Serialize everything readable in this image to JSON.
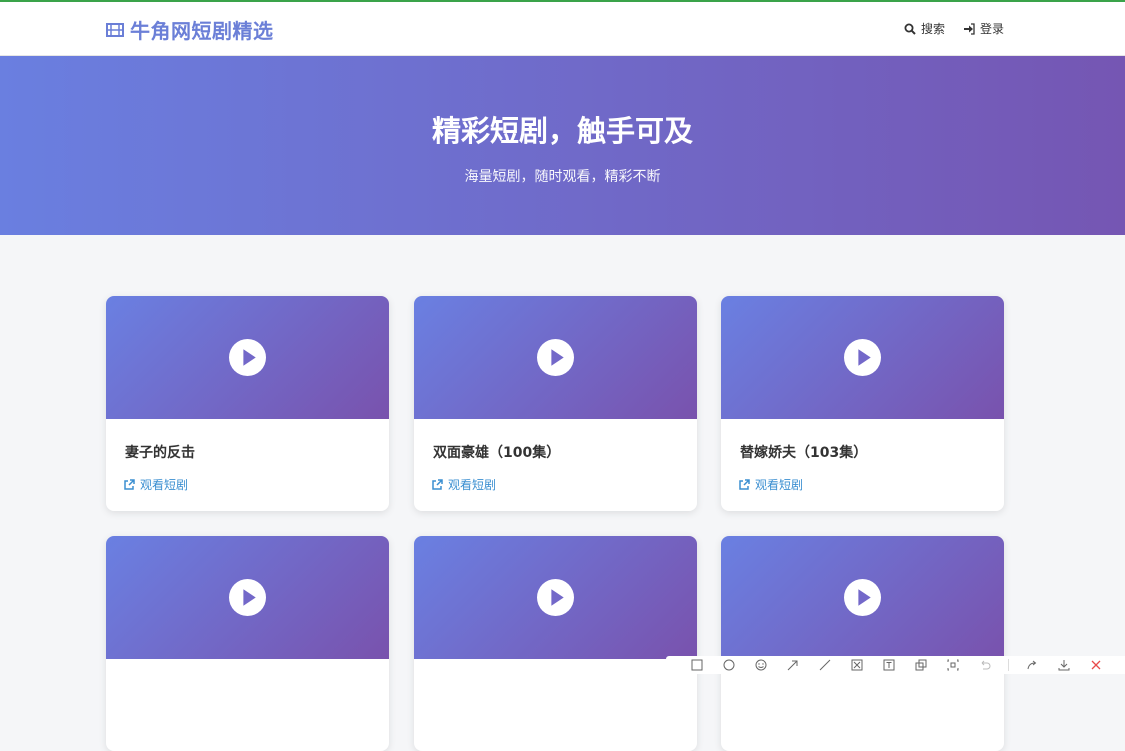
{
  "brand": {
    "title": "牛角网短剧精选",
    "color": "#6b7fd7"
  },
  "nav": {
    "search_label": "搜索",
    "login_label": "登录"
  },
  "hero": {
    "title": "精彩短剧，触手可及",
    "subtitle": "海量短剧，随时观看，精彩不断"
  },
  "cards": [
    {
      "title": "妻子的反击",
      "link_label": "观看短剧"
    },
    {
      "title": "双面豪雄（100集）",
      "link_label": "观看短剧"
    },
    {
      "title": "替嫁娇夫（103集）",
      "link_label": "观看短剧"
    },
    {
      "title": "",
      "link_label": ""
    },
    {
      "title": "",
      "link_label": ""
    },
    {
      "title": "",
      "link_label": ""
    }
  ],
  "toolbar_icons": [
    "rectangle-icon",
    "circle-icon",
    "emoji-icon",
    "arrow-icon",
    "line-icon",
    "mosaic-icon",
    "text-icon",
    "copy-icon",
    "pin-icon",
    "undo-icon",
    "share-icon",
    "save-icon",
    "close-icon"
  ]
}
